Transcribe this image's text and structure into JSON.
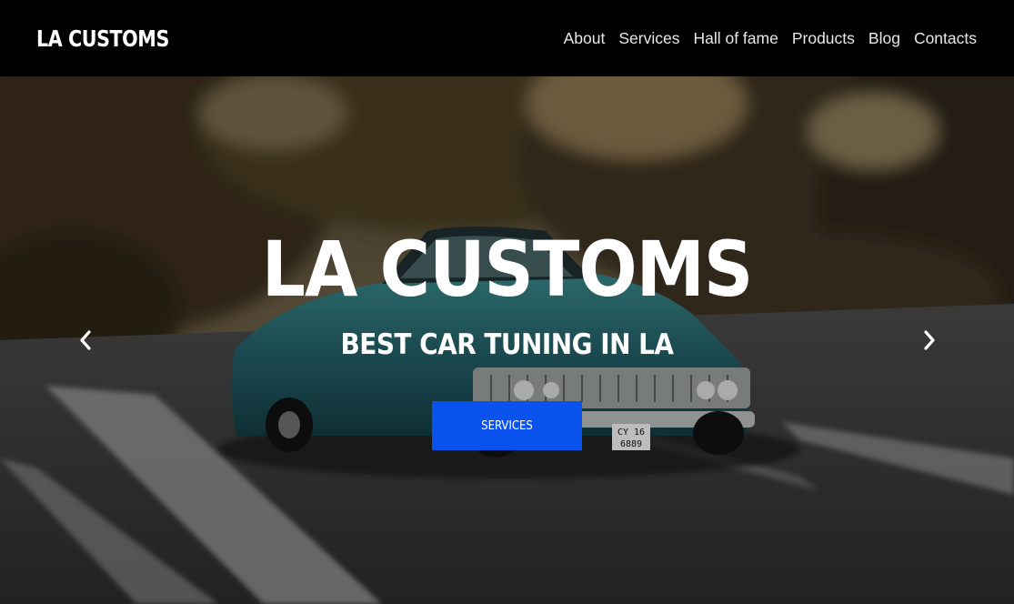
{
  "navbar": {
    "logo": "LA CUSTOMS",
    "links": [
      "About",
      "Services",
      "Hall of fame",
      "Products",
      "Blog",
      "Contacts"
    ]
  },
  "hero": {
    "title": "LA CUSTOMS",
    "subtitle": "BEST CAR TUNING IN LA",
    "button_label": "SERVICES",
    "prev_icon": "chevron-left-icon",
    "next_icon": "chevron-right-icon",
    "background_image": "teal-vintage-car-driving-on-road-with-motion-blur-trees",
    "license_plate_lines": [
      "CY 16",
      "6889"
    ]
  },
  "colors": {
    "navbar_bg": "#000000",
    "accent_button": "#0a52ee",
    "text": "#ffffff",
    "car_body": "#2d6d72"
  }
}
